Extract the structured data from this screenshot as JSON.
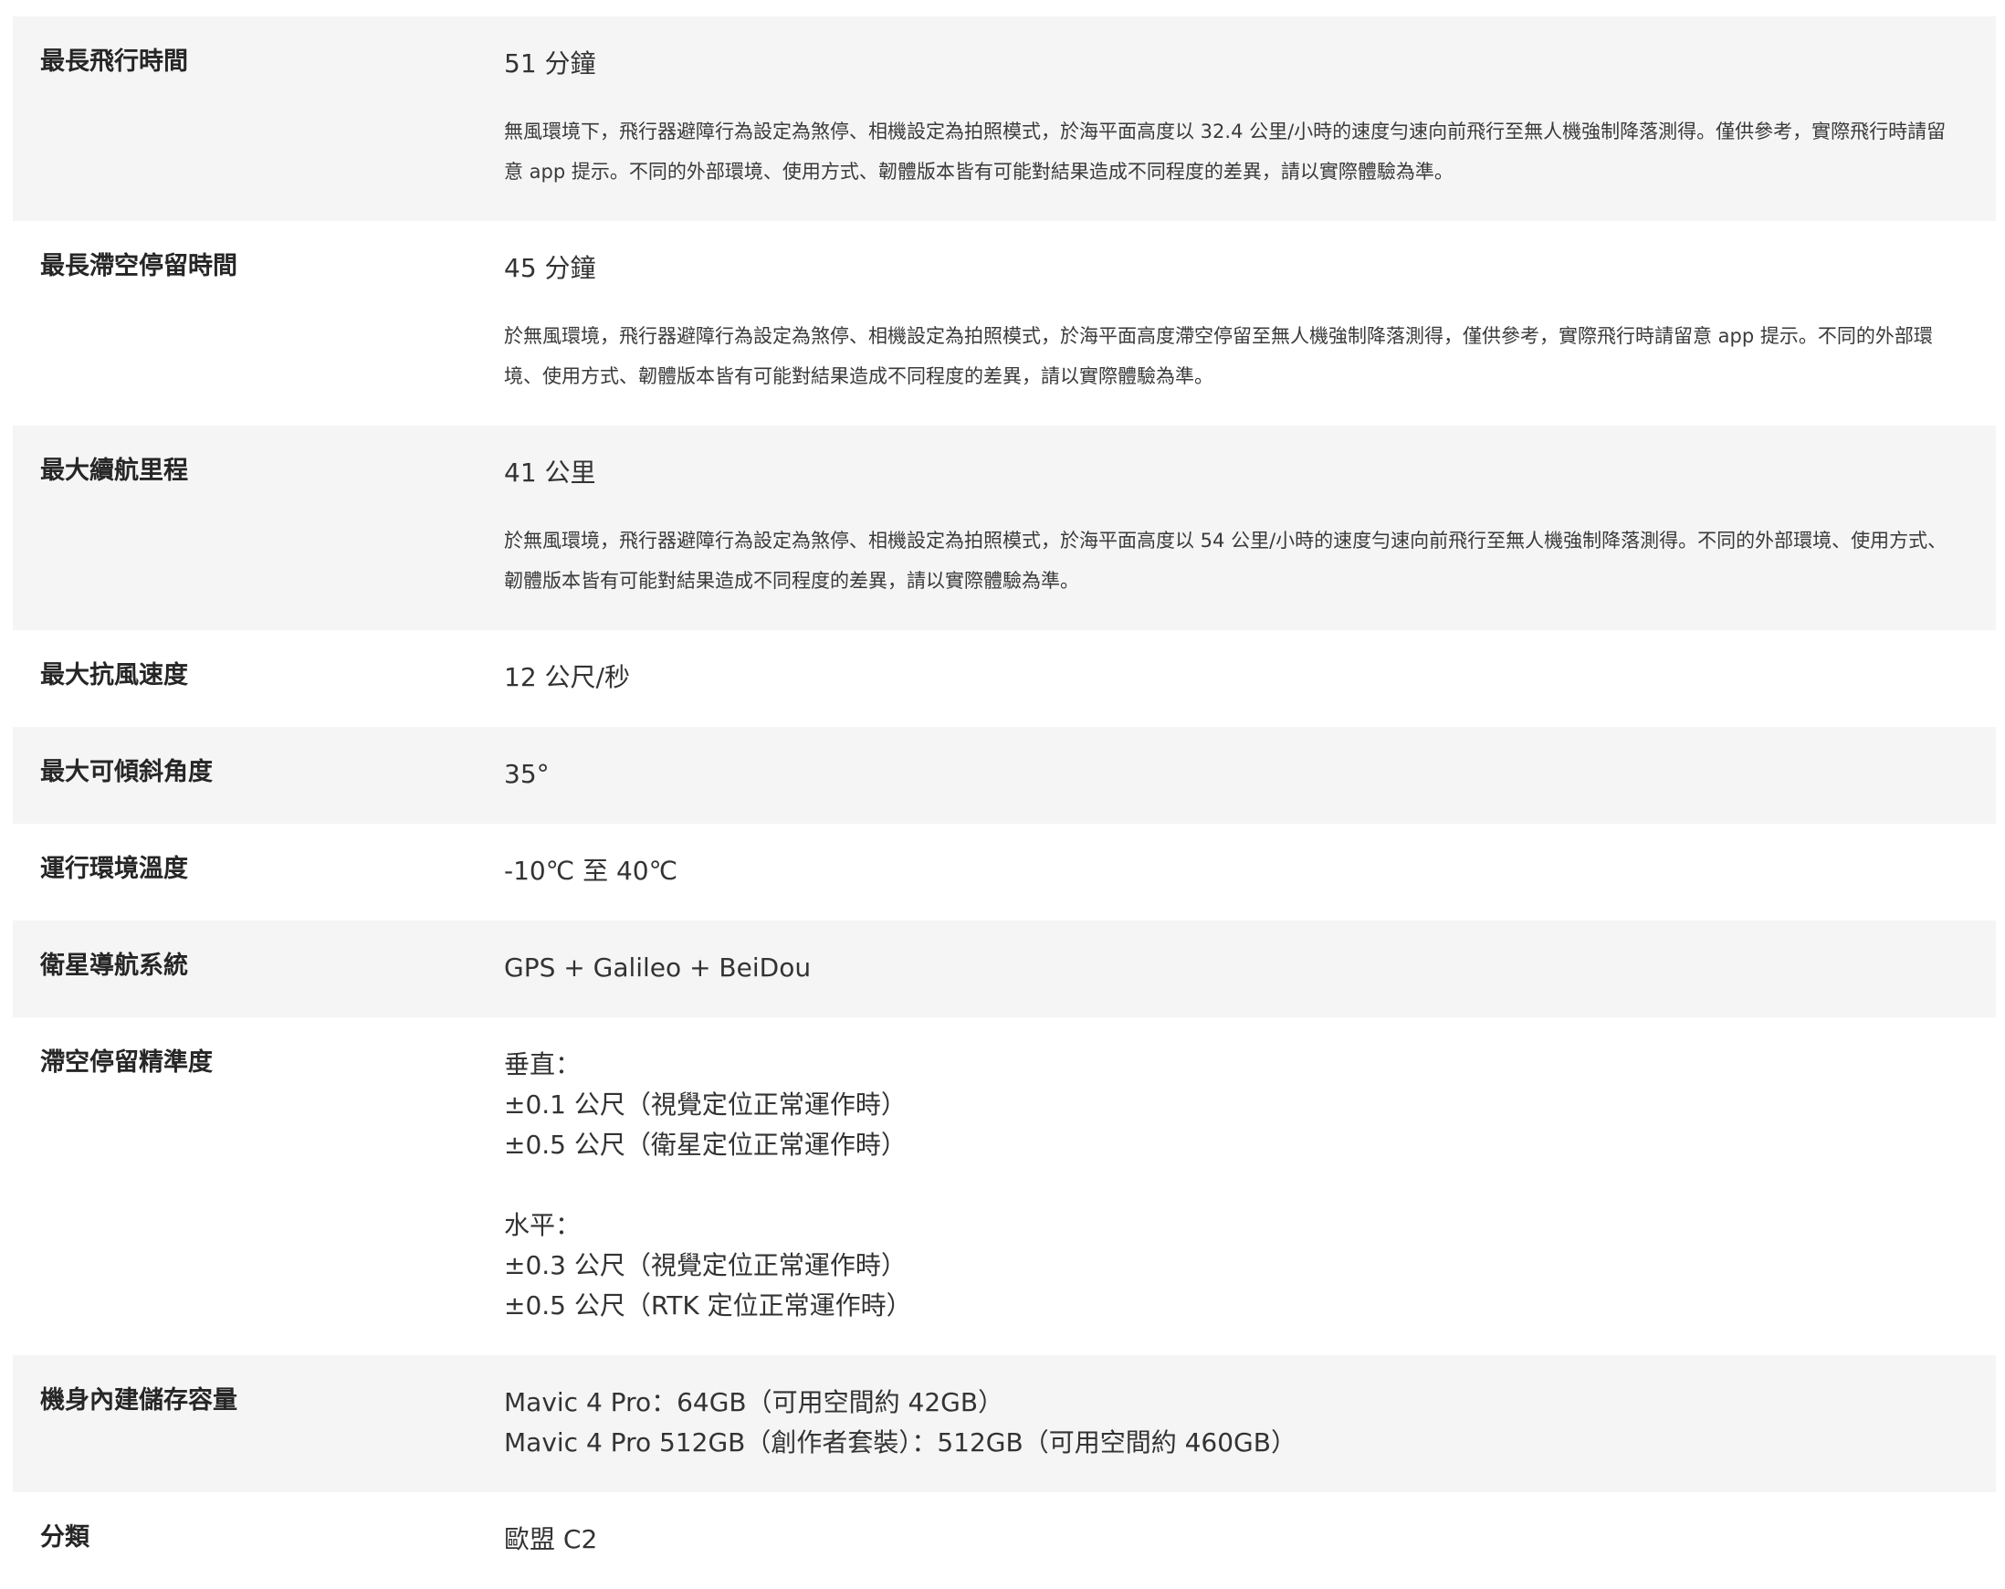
{
  "specs": [
    {
      "label": "最長飛行時間",
      "value": "51 分鐘",
      "note": "無風環境下，飛行器避障行為設定為煞停、相機設定為拍照模式，於海平面高度以 32.4 公里/小時的速度勻速向前飛行至無人機強制降落測得。僅供參考，實際飛行時請留意 app 提示。不同的外部環境、使用方式、韌體版本皆有可能對結果造成不同程度的差異，請以實際體驗為準。"
    },
    {
      "label": "最長滯空停留時間",
      "value": "45 分鐘",
      "note": "於無風環境，飛行器避障行為設定為煞停、相機設定為拍照模式，於海平面高度滯空停留至無人機強制降落測得，僅供參考，實際飛行時請留意 app 提示。不同的外部環境、使用方式、韌體版本皆有可能對結果造成不同程度的差異，請以實際體驗為準。"
    },
    {
      "label": "最大續航里程",
      "value": "41 公里",
      "note": "於無風環境，飛行器避障行為設定為煞停、相機設定為拍照模式，於海平面高度以 54 公里/小時的速度勻速向前飛行至無人機強制降落測得。不同的外部環境、使用方式、韌體版本皆有可能對結果造成不同程度的差異，請以實際體驗為準。"
    },
    {
      "label": "最大抗風速度",
      "value": "12 公尺/秒"
    },
    {
      "label": "最大可傾斜角度",
      "value": "35°"
    },
    {
      "label": "運行環境溫度",
      "value": "-10℃ 至 40℃"
    },
    {
      "label": "衛星導航系統",
      "value": "GPS + Galileo + BeiDou"
    },
    {
      "label": "滯空停留精準度",
      "value": "垂直：\n±0.1 公尺（視覺定位正常運作時）\n±0.5 公尺（衛星定位正常運作時）\n\n水平：\n±0.3 公尺（視覺定位正常運作時）\n±0.5 公尺（RTK 定位正常運作時）"
    },
    {
      "label": "機身內建儲存容量",
      "value": "Mavic 4 Pro：64GB（可用空間約 42GB）\nMavic 4 Pro 512GB（創作者套裝）：512GB（可用空間約 460GB）"
    },
    {
      "label": "分類",
      "value": "歐盟 C2"
    }
  ]
}
